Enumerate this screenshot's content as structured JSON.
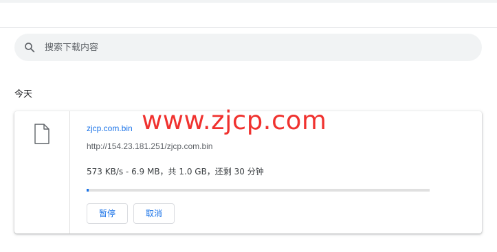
{
  "search": {
    "placeholder": "搜索下载内容",
    "icon": "search-icon"
  },
  "section": {
    "date_label": "今天"
  },
  "download": {
    "file_icon": "file-icon",
    "file_name": "zjcp.com.bin",
    "url": "http://154.23.181.251/zjcp.com.bin",
    "status": "573 KB/s - 6.9 MB，共 1.0 GB，还剩 30 分钟",
    "progress_fraction": 0.0067,
    "pause_label": "暂停",
    "cancel_label": "取消"
  },
  "watermark": {
    "text": "www.zjcp.com"
  },
  "colors": {
    "accent": "#1a73e8",
    "watermark": "#f0322f",
    "search_bg": "#f1f3f4"
  }
}
